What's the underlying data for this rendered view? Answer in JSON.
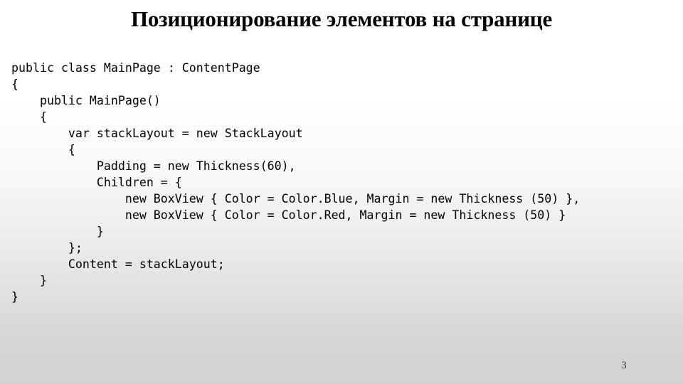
{
  "slide": {
    "title": "Позиционирование элементов на странице",
    "page_number": "3",
    "background": {
      "top_color": "#ffffff",
      "bottom_color": "#d1d1d1"
    },
    "text_color": "#000000"
  },
  "code": {
    "language": "csharp",
    "lines": [
      "public class MainPage : ContentPage",
      "{",
      "    public MainPage()",
      "    {",
      "        var stackLayout = new StackLayout",
      "        {",
      "            Padding = new Thickness(60),",
      "            Children = {",
      "                new BoxView { Color = Color.Blue, Margin = new Thickness (50) },",
      "                new BoxView { Color = Color.Red, Margin = new Thickness (50) }",
      "            }",
      "        };",
      "        Content = stackLayout;",
      "    }",
      "}"
    ]
  }
}
